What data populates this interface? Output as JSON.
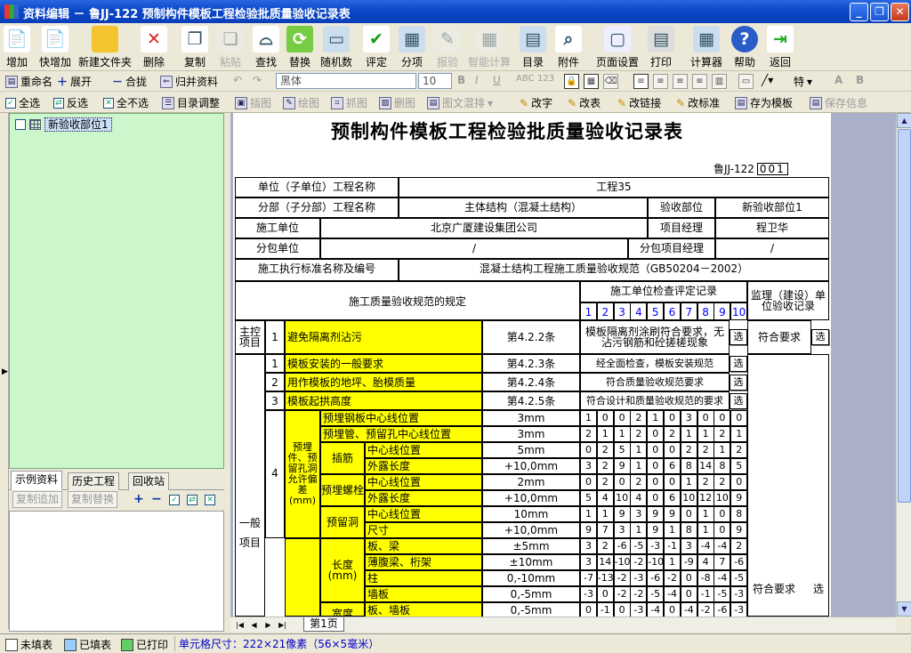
{
  "window": {
    "title": "资料编辑 － 鲁JJ-122 预制构件模板工程检验批质量验收记录表"
  },
  "toolbar": [
    {
      "label": "增加",
      "icon": "add-doc-icon",
      "enabled": true
    },
    {
      "label": "快增加",
      "icon": "quick-add-icon",
      "enabled": true
    },
    {
      "label": "新建文件夹",
      "icon": "folder-icon",
      "enabled": true
    },
    {
      "label": "删除",
      "icon": "delete-icon",
      "enabled": true
    },
    {
      "label": "复制",
      "icon": "copy-icon",
      "enabled": true
    },
    {
      "label": "粘贴",
      "icon": "paste-icon",
      "enabled": false
    },
    {
      "label": "查找",
      "icon": "binoculars-icon",
      "enabled": true
    },
    {
      "label": "替换",
      "icon": "replace-icon",
      "enabled": true
    },
    {
      "label": "随机数",
      "icon": "random-icon",
      "enabled": true
    },
    {
      "label": "评定",
      "icon": "check-icon",
      "enabled": true
    },
    {
      "label": "分项",
      "icon": "tree-icon",
      "enabled": true
    },
    {
      "label": "报验",
      "icon": "report-icon",
      "enabled": false
    },
    {
      "label": "智能计算",
      "icon": "calc-grid-icon",
      "enabled": false
    },
    {
      "label": "目录",
      "icon": "catalog-icon",
      "enabled": true
    },
    {
      "label": "附件",
      "icon": "paperclip-icon",
      "enabled": true
    },
    {
      "label": "页面设置",
      "icon": "page-setup-icon",
      "enabled": true
    },
    {
      "label": "打印",
      "icon": "printer-icon",
      "enabled": true
    },
    {
      "label": "计算器",
      "icon": "calculator-icon",
      "enabled": true
    },
    {
      "label": "帮助",
      "icon": "help-icon",
      "enabled": true
    },
    {
      "label": "返回",
      "icon": "exit-icon",
      "enabled": true
    }
  ],
  "left_toolbar2": {
    "rename": "重命名",
    "expand": "展开",
    "collapse": "合拢",
    "merge": "归并资料"
  },
  "left_toolbar3": {
    "select_all": "全选",
    "invert": "反选",
    "select_none": "全不选",
    "catalog_adjust": "目录调整"
  },
  "format": {
    "font": "黑体",
    "size": "10",
    "bold": "B",
    "italic": "I",
    "underline": "U",
    "super": "ABC",
    "sub": "123",
    "char": "特",
    "a1": "A",
    "b1": "B"
  },
  "insert_toolbar": {
    "insert_img": "插图",
    "draw": "绘图",
    "capture": "抓图",
    "delete_img": "删图",
    "mix": "图文混排",
    "modify_char": "改字",
    "modify_table": "改表",
    "modify_link": "改链接",
    "modify_std": "改标准",
    "save_template": "存为模板",
    "save_info": "保存信息"
  },
  "tree": {
    "item": "新验收部位1"
  },
  "left_tabs": {
    "t1": "示例资料",
    "t2": "历史工程",
    "t3": "回收站",
    "copy_append": "复制追加",
    "copy_replace": "复制替换"
  },
  "sheet": {
    "tab": "第1页"
  },
  "status": {
    "unfilled": "未填表",
    "filled": "已填表",
    "printed": "已打印",
    "cell_size": "单元格尺寸：222×21像素（56×5毫米）"
  },
  "colors": {
    "highlight": "#ffff00",
    "leftpanel": "#ccf7cc",
    "title_bar": "#0a47c8"
  },
  "form": {
    "title": "预制构件模板工程检验批质量验收记录表",
    "code_label": "鲁JJ-122",
    "code_no": "001",
    "unit_label": "单位（子单位）工程名称",
    "unit_value": "工程35",
    "part_label": "分部（子分部）工程名称",
    "part_value": "主体结构（混凝土结构）",
    "acc_label": "验收部位",
    "acc_value": "新验收部位1",
    "builder_label": "施工单位",
    "builder_value": "北京广厦建设集团公司",
    "pm_label": "项目经理",
    "pm_value": "程卫华",
    "sub_label": "分包单位",
    "sub_value": "/",
    "subpm_label": "分包项目经理",
    "subpm_value": "/",
    "std_label": "施工执行标准名称及编号",
    "std_value": "混凝土结构工程施工质量验收规范（GB50204－2002）",
    "spec_header": "施工质量验收规范的规定",
    "check_header": "施工单位检查评定记录",
    "super_header": "监理（建设）单位验收记录",
    "nums": [
      "1",
      "2",
      "3",
      "4",
      "5",
      "6",
      "7",
      "8",
      "9",
      "10"
    ],
    "main_label": "主控项目",
    "general_label": "一般项目",
    "sel": "选",
    "ok": "符合要求",
    "main": [
      {
        "no": "1",
        "item": "避免隔离剂沾污",
        "clause": "第4.2.2条",
        "rec": "模板隔离剂涂刷符合要求，无沾污钢筋和砼搓槎现象"
      }
    ],
    "general": [
      {
        "no": "1",
        "item": "模板安装的一般要求",
        "clause": "第4.2.3条",
        "rec": "经全面检查，模板安装规范"
      },
      {
        "no": "2",
        "item": "用作模板的地坪、胎模质量",
        "clause": "第4.2.4条",
        "rec": "符合质量验收规范要求"
      },
      {
        "no": "3",
        "item": "模板起拱高度",
        "clause": "第4.2.5条",
        "rec": "符合设计和质量验收规范的要求"
      }
    ],
    "dev_no": "4",
    "dev_label": "预埋件、预留孔洞允许偏差(mm)",
    "dev_rows": [
      {
        "g1": "预埋钢板中心线位置",
        "g2": "",
        "tol": "3mm",
        "v": [
          "1",
          "0",
          "0",
          "2",
          "1",
          "0",
          "3",
          "0",
          "0",
          "0"
        ]
      },
      {
        "g1": "预埋管、预留孔中心线位置",
        "g2": "",
        "tol": "3mm",
        "v": [
          "2",
          "1",
          "1",
          "2",
          "0",
          "2",
          "1",
          "1",
          "2",
          "1"
        ]
      },
      {
        "g1": "插筋",
        "g2": "中心线位置",
        "tol": "5mm",
        "v": [
          "0",
          "2",
          "5",
          "1",
          "0",
          "0",
          "2",
          "2",
          "1",
          "2"
        ]
      },
      {
        "g1": "",
        "g2": "外露长度",
        "tol": "+10,0mm",
        "v": [
          "3",
          "2",
          "9",
          "1",
          "0",
          "6",
          "8",
          "14",
          "8",
          "5"
        ]
      },
      {
        "g1": "预埋螺栓",
        "g2": "中心线位置",
        "tol": "2mm",
        "v": [
          "0",
          "2",
          "0",
          "2",
          "0",
          "0",
          "1",
          "2",
          "2",
          "0"
        ]
      },
      {
        "g1": "",
        "g2": "外露长度",
        "tol": "+10,0mm",
        "v": [
          "5",
          "4",
          "10",
          "4",
          "0",
          "6",
          "10",
          "12",
          "10",
          "9"
        ]
      },
      {
        "g1": "预留洞",
        "g2": "中心线位置",
        "tol": "10mm",
        "v": [
          "1",
          "1",
          "9",
          "3",
          "9",
          "9",
          "0",
          "1",
          "0",
          "8"
        ]
      },
      {
        "g1": "",
        "g2": "尺寸",
        "tol": "+10,0mm",
        "v": [
          "9",
          "7",
          "3",
          "1",
          "9",
          "1",
          "8",
          "1",
          "0",
          "9"
        ]
      }
    ],
    "size_label": "长度(mm)",
    "width_label": "宽度",
    "size_rows": [
      {
        "item": "板、梁",
        "tol": "±5mm",
        "v": [
          "3",
          "2",
          "-6",
          "-5",
          "-3",
          "-1",
          "3",
          "-4",
          "-4",
          "2"
        ]
      },
      {
        "item": "薄腹梁、桁架",
        "tol": "±10mm",
        "v": [
          "3",
          "14",
          "-10",
          "-2",
          "-10",
          "1",
          "-9",
          "4",
          "7",
          "-6"
        ]
      },
      {
        "item": "柱",
        "tol": "0,-10mm",
        "v": [
          "-7",
          "-13",
          "-2",
          "-3",
          "-6",
          "-2",
          "0",
          "-8",
          "-4",
          "-5"
        ]
      },
      {
        "item": "墙板",
        "tol": "0,-5mm",
        "v": [
          "-3",
          "0",
          "-2",
          "-2",
          "-5",
          "-4",
          "0",
          "-1",
          "-5",
          "-3"
        ]
      },
      {
        "item": "板、墙板",
        "tol": "0,-5mm",
        "v": [
          "0",
          "-1",
          "0",
          "-3",
          "-4",
          "0",
          "-4",
          "-2",
          "-6",
          "-3"
        ]
      }
    ]
  }
}
